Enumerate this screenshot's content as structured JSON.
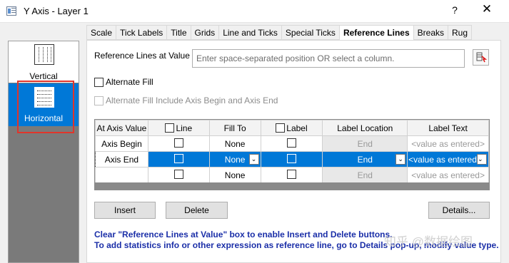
{
  "window": {
    "title": "Y Axis - Layer 1",
    "help_label": "?",
    "close_label": "✕"
  },
  "sidebar": {
    "items": [
      {
        "label": "Vertical",
        "icon": "vertical-lines-icon"
      },
      {
        "label": "Horizontal",
        "icon": "horizontal-lines-icon",
        "selected": true
      }
    ]
  },
  "tabs": [
    {
      "label": "Scale"
    },
    {
      "label": "Tick Labels"
    },
    {
      "label": "Title"
    },
    {
      "label": "Grids"
    },
    {
      "label": "Line and Ticks"
    },
    {
      "label": "Special Ticks"
    },
    {
      "label": "Reference Lines",
      "active": true
    },
    {
      "label": "Breaks"
    },
    {
      "label": "Rug"
    }
  ],
  "reference": {
    "label": "Reference Lines at Value",
    "placeholder": "Enter space-separated position OR select a column.",
    "value": ""
  },
  "options": {
    "alternate_fill": "Alternate Fill",
    "alternate_fill_include": "Alternate Fill Include Axis Begin and Axis End"
  },
  "grid": {
    "headers": [
      "At Axis Value",
      "Line",
      "Fill To",
      "Label",
      "Label Location",
      "Label Text"
    ],
    "rows": [
      {
        "axis_value": "Axis Begin",
        "fill_to": "None",
        "label_location": "End",
        "label_text": "<value as entered>"
      },
      {
        "axis_value": "Axis End",
        "fill_to": "None",
        "label_location": "End",
        "label_text": "<value as entered>",
        "selected": true
      },
      {
        "axis_value": "",
        "fill_to": "None",
        "label_location": "End",
        "label_text": "<value as entered>"
      }
    ]
  },
  "buttons": {
    "insert": "Insert",
    "delete": "Delete",
    "details": "Details..."
  },
  "hints": {
    "line1": "Clear \"Reference Lines at Value\" box to enable Insert and Delete buttons.",
    "line2": "To add statistics info or other expression as reference line, go to Details pop-up, modify value type."
  },
  "watermark": "知乎 @数据绘图",
  "colors": {
    "selection": "#0078d7",
    "highlight_border": "#e0352b",
    "hint_text": "#1b2fa8"
  }
}
